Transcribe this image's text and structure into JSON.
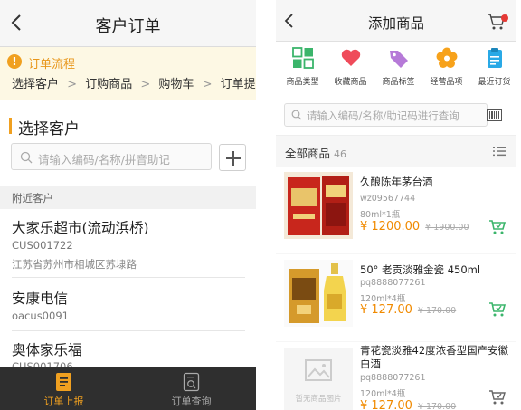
{
  "left": {
    "header": {
      "title": "客户订单",
      "back_icon": "chevron-left-icon"
    },
    "flow": {
      "title": "订单流程",
      "steps": [
        "选择客户",
        "订购商品",
        "购物车",
        "订单提交"
      ],
      "separator": ">"
    },
    "section_title": "选择客户",
    "search": {
      "placeholder": "请输入编码/名称/拼音助记"
    },
    "nearby_label": "附近客户",
    "customers": [
      {
        "name": "大家乐超市(流动浜桥)",
        "code": "CUS001722",
        "address": "江苏省苏州市相城区苏埭路"
      },
      {
        "name": "安康电信",
        "code": "oacus0091",
        "address": ""
      },
      {
        "name": "奥体家乐福",
        "code": "CUS001706",
        "address": ""
      }
    ],
    "tabbar": {
      "tabs": [
        {
          "label": "订单上报",
          "icon": "order-report-icon",
          "active": true
        },
        {
          "label": "订单查询",
          "icon": "order-search-icon",
          "active": false
        }
      ],
      "active_color": "#f0a020",
      "inactive_color": "#aaaaaa"
    }
  },
  "right": {
    "header": {
      "title": "添加商品",
      "back_icon": "chevron-left-icon",
      "cart_icon": "cart-icon"
    },
    "categories": [
      {
        "label": "商品类型",
        "icon": "grid-icon",
        "color": "#3bb56b"
      },
      {
        "label": "收藏商品",
        "icon": "heart-icon",
        "color": "#ef4b5a"
      },
      {
        "label": "商品标签",
        "icon": "tag-icon",
        "color": "#b67ad8"
      },
      {
        "label": "经营品项",
        "icon": "flower-icon",
        "color": "#f7a21b"
      },
      {
        "label": "最近订货",
        "icon": "clipboard-icon",
        "color": "#29a9e6"
      }
    ],
    "search": {
      "placeholder": "请输入编码/名称/助记码进行查询"
    },
    "all_label": "全部商品",
    "all_count": "46",
    "products": [
      {
        "name": "久酿陈年茅台酒",
        "code": "wz09567744",
        "pack": "80ml*1瓶",
        "price": "¥ 1200.00",
        "orig_price": "¥ 1900.00",
        "image_icon": "liquor-box-icon"
      },
      {
        "name": "50° 老贡淡雅金瓷 450ml",
        "code": "pq8888077261",
        "pack": "120ml*4瓶",
        "price": "¥ 127.00",
        "orig_price": "¥ 170.00",
        "image_icon": "liquor-bottle-icon"
      },
      {
        "name": "青花瓷淡雅42度浓香型国产安徽白酒",
        "code": "pq8888077261",
        "pack": "120ml*4瓶",
        "price": "¥ 127.00",
        "orig_price": "¥ 170.00",
        "image_icon": "image-placeholder-icon",
        "image_placeholder_text": "暂无商品图片"
      }
    ],
    "accent_color": "#f08a00",
    "cart_add_color": "#3bb56b"
  }
}
